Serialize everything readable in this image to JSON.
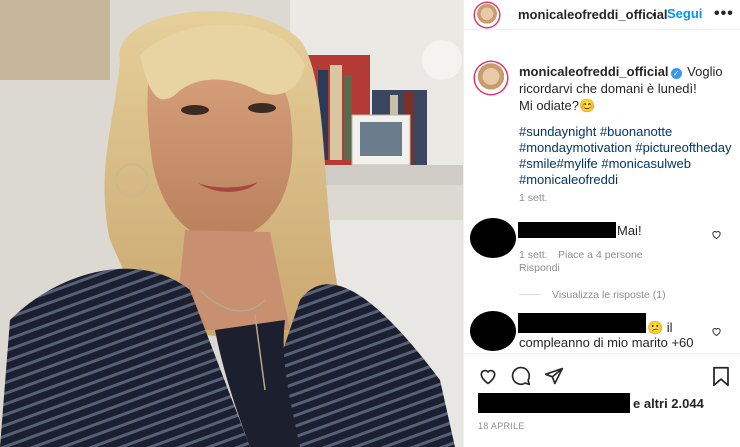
{
  "post": {
    "username": "monicaleofreddi_official",
    "follow_label": "Segui",
    "header_dot": "•",
    "more_label": "•••"
  },
  "caption": {
    "username": "monicaleofreddi_official",
    "text_line1": "Voglio",
    "text_line2": "ricordarvi che domani è lunedì!",
    "text_line3": "Mi odiate?😊",
    "hashtags": [
      "#sundaynight #buonanotte",
      "#mondaymotivation #pictureoftheday",
      "#smile#mylife #monicasulweb",
      "#monicaleofreddi"
    ],
    "time": "1 sett."
  },
  "comments": [
    {
      "text": "Mai!",
      "time": "1 sett.",
      "likes": "Piace a 4 persone",
      "reply": "Rispondi",
      "view_replies": "Visualizza le risposte (1)"
    },
    {
      "text_line1": "😕 il",
      "text_line2": "compleanno di mio marito +60"
    }
  ],
  "footer": {
    "likes_suffix": "e altri 2.044",
    "date": "18 APRILE"
  },
  "icons": {
    "heart": "heart-icon",
    "comment": "comment-icon",
    "share": "share-icon",
    "save": "save-icon"
  },
  "colors": {
    "link": "#0095f6",
    "hashtag": "#00376b",
    "muted": "#8e8e8e",
    "text": "#262626"
  }
}
